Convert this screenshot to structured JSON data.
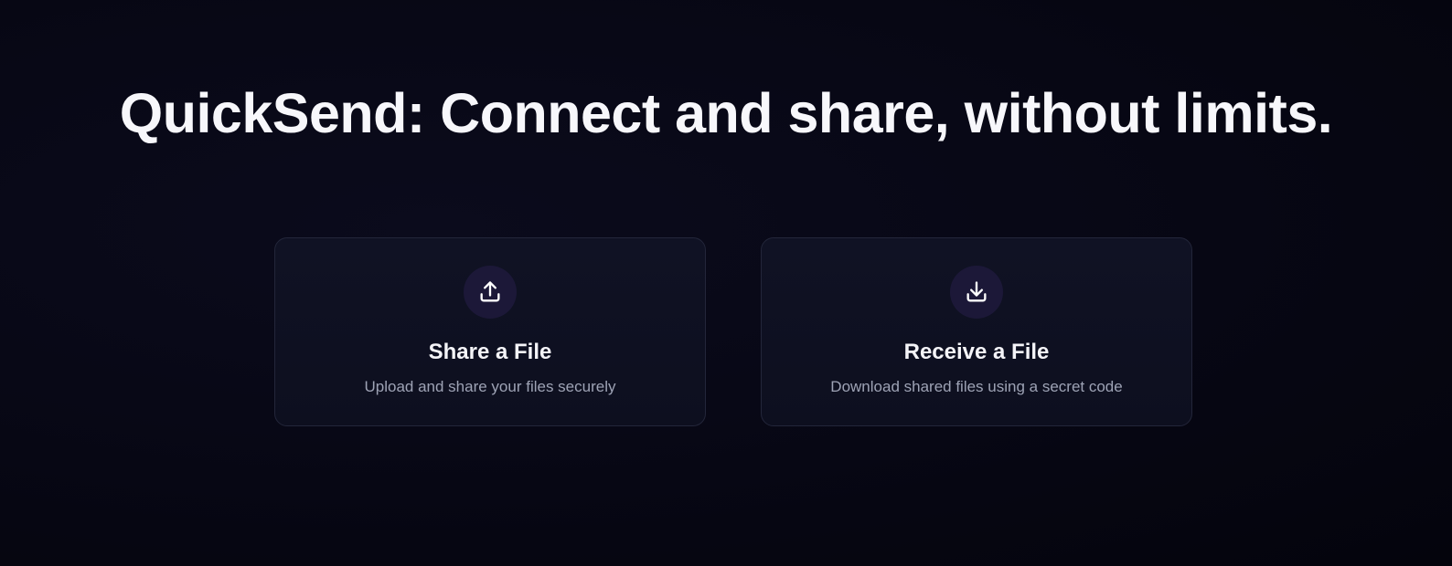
{
  "hero": {
    "title": "QuickSend: Connect and share, without limits."
  },
  "cards": [
    {
      "icon": "upload-icon",
      "title": "Share a File",
      "description": "Upload and share your files securely"
    },
    {
      "icon": "download-icon",
      "title": "Receive a File",
      "description": "Download shared files using a secret code"
    }
  ],
  "colors": {
    "background": "#070714",
    "card_background": "#0f1122",
    "card_border": "#23263a",
    "icon_circle": "#1c1838",
    "title_text": "#f7f7fb",
    "muted_text": "#9ea3b5"
  }
}
